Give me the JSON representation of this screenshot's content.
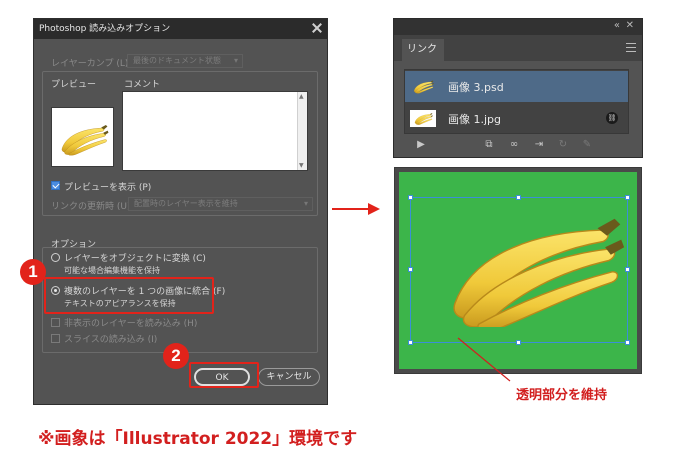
{
  "dialog": {
    "title": "Photoshop 読み込みオプション",
    "layer_comp_label": "レイヤーカンプ (L) :",
    "layer_comp_value": "最後のドキュメント状態",
    "preview_label": "プレビュー",
    "comment_label": "コメント",
    "show_preview_label": "プレビューを表示 (P)",
    "update_links_label": "リンクの更新時 (U) :",
    "update_links_value": "配置時のレイヤー表示を維持",
    "options_label": "オプション",
    "opt_convert_label": "レイヤーをオブジェクトに変換 (C)",
    "opt_convert_sub": "可能な場合編集機能を保持",
    "opt_flatten_label": "複数のレイヤーを 1 つの画像に統合 (F)",
    "opt_flatten_sub": "テキストのアピアランスを保持",
    "import_hidden_label": "非表示のレイヤーを読み込み (H)",
    "import_slices_label": "スライスの読み込み (I)",
    "ok_label": "OK",
    "cancel_label": "キャンセル"
  },
  "badges": {
    "one": "1",
    "two": "2"
  },
  "links_panel": {
    "tab_label": "リンク",
    "items": [
      {
        "name": "画像 3.psd",
        "active": true
      },
      {
        "name": "画像 1.jpg",
        "active": false
      }
    ]
  },
  "annotations": {
    "transparency": "透明部分を維持",
    "environment_note": "※画象は「Illustrator 2022」環境です"
  },
  "colors": {
    "accent_red": "#e2231a",
    "artboard_green": "#3cb54a",
    "selection_blue": "#3b8fd8",
    "dialog_bg": "#535353"
  }
}
